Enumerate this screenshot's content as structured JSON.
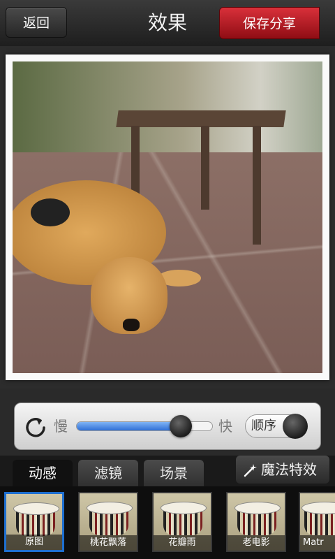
{
  "header": {
    "back_label": "返回",
    "title": "效果",
    "save_label": "保存分享"
  },
  "controls": {
    "slow_label": "慢",
    "fast_label": "快",
    "speed_percent": 77,
    "order_label": "顺序"
  },
  "tabs": [
    {
      "label": "动感",
      "active": true
    },
    {
      "label": "滤镜",
      "active": false
    },
    {
      "label": "场景",
      "active": false
    }
  ],
  "magic_label": "魔法特效",
  "thumbnails": [
    {
      "label": "原图",
      "selected": true
    },
    {
      "label": "桃花飘落",
      "selected": false
    },
    {
      "label": "花瓣雨",
      "selected": false
    },
    {
      "label": "老电影",
      "selected": false
    },
    {
      "label": "Matr",
      "selected": false
    }
  ],
  "colors": {
    "accent_red": "#c81e28",
    "slider_blue": "#2f6fd6",
    "selected_border": "#1e6fd0"
  },
  "icons": {
    "refresh": "refresh-icon",
    "magic": "magic-wand-icon"
  }
}
